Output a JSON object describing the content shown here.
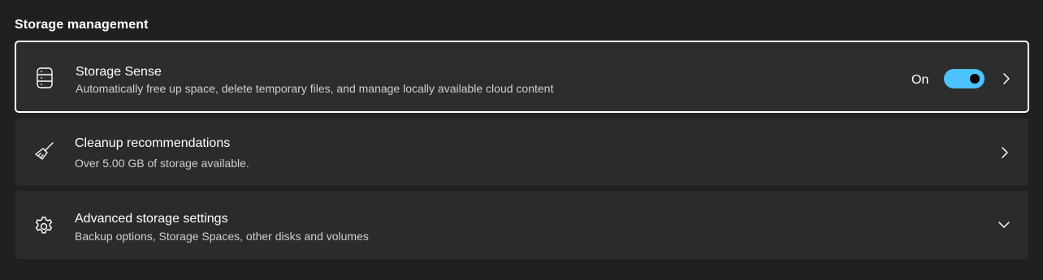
{
  "section": {
    "title": "Storage management"
  },
  "storage_sense": {
    "icon": "server-storage-icon",
    "title": "Storage Sense",
    "subtitle": "Automatically free up space, delete temporary files, and manage locally available cloud content",
    "toggle_label": "On",
    "toggle_on": true,
    "accent_color": "#4cc2ff"
  },
  "cleanup": {
    "icon": "broom-icon",
    "title": "Cleanup recommendations",
    "subtitle": "Over 5.00 GB of storage available."
  },
  "advanced": {
    "icon": "gear-icon",
    "title": "Advanced storage settings",
    "subtitle": "Backup options, Storage Spaces, other disks and volumes"
  }
}
